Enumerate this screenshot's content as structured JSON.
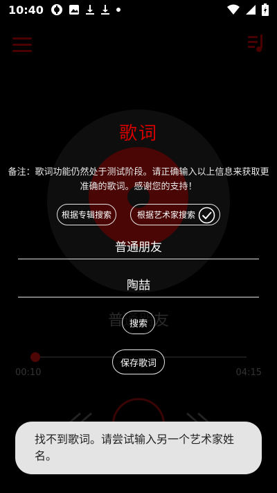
{
  "status_bar": {
    "time": "10:40",
    "left_icons": [
      "vpn-key-icon",
      "image-icon",
      "download-icon",
      "download-icon",
      "dot-icon"
    ],
    "right_icons": [
      "wifi-icon",
      "signal-icon",
      "battery-charging-icon"
    ]
  },
  "player_background": {
    "song_title": "普通朋友",
    "time_elapsed": "00:10",
    "time_total": "04:15",
    "accent_color": "#d40000"
  },
  "lyrics_dialog": {
    "title": "歌词",
    "note": "备注：歌词功能仍然处于测试阶段。请正确输入以上信息来获取更准确的歌词。感谢您的支持！",
    "option_album": "根据专辑搜索",
    "option_artist": "根据艺术家搜索",
    "selected_option": "根据艺术家搜索",
    "song_field_value": "普通朋友",
    "artist_field_value": "陶喆",
    "search_button": "搜索",
    "save_button": "保存歌词"
  },
  "toast": {
    "message": "找不到歌词。请尝试输入另一个艺术家姓名。"
  }
}
